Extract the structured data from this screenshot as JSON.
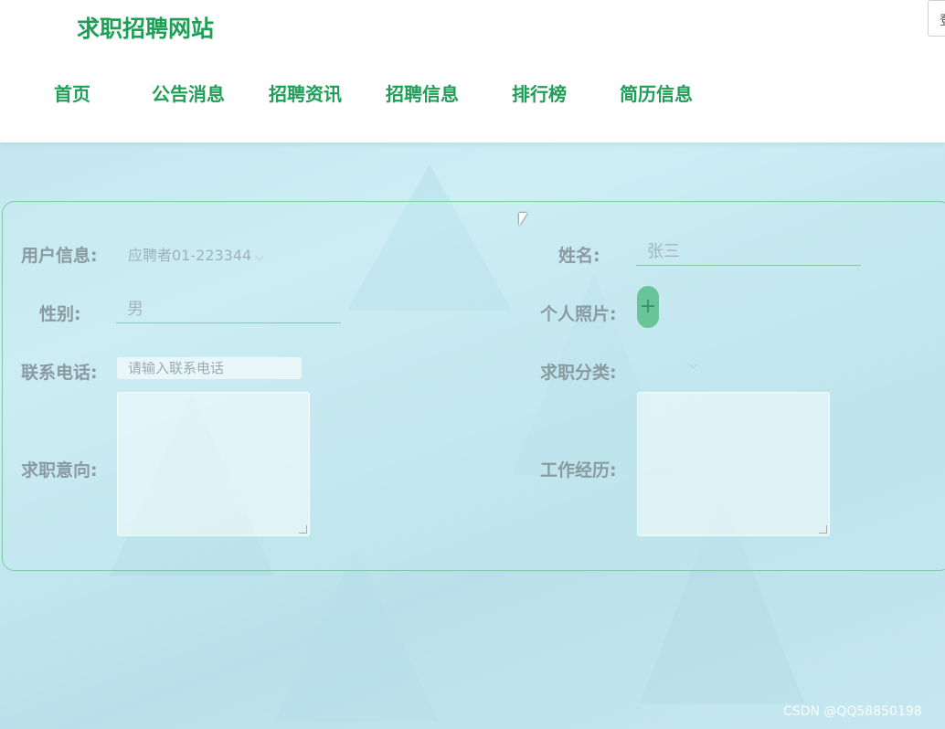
{
  "site": {
    "title": "求职招聘网站",
    "top_right_text": "登"
  },
  "nav": {
    "items": [
      "首页",
      "公告消息",
      "招聘资讯",
      "招聘信息",
      "排行榜",
      "简历信息"
    ]
  },
  "form": {
    "user_info": {
      "label": "用户信息:",
      "value": "应聘者01-223344"
    },
    "name": {
      "label": "姓名:",
      "value": "张三"
    },
    "gender": {
      "label": "性别:",
      "value": "男"
    },
    "photo": {
      "label": "个人照片:",
      "button": "+"
    },
    "phone": {
      "label": "联系电话:",
      "placeholder": "请输入联系电话"
    },
    "category": {
      "label": "求职分类:",
      "value": ""
    },
    "intention": {
      "label": "求职意向:"
    },
    "experience": {
      "label": "工作经历:"
    }
  },
  "watermark": "CSDN @QQ58850198",
  "colors": {
    "brand": "#1e9e57",
    "accent": "#6ac49a"
  },
  "icons": {
    "dropdown": "chevron-down-icon",
    "add": "plus-icon",
    "cursor": "mouse-cursor-icon"
  }
}
